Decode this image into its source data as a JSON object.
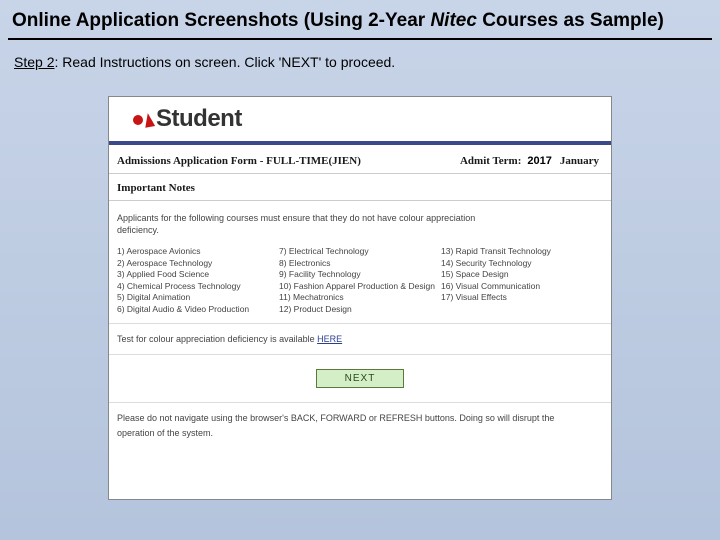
{
  "page": {
    "title_pre": "Online Application Screenshots (Using 2-Year ",
    "title_italic": "Nitec",
    "title_post": " Courses as Sample)"
  },
  "step": {
    "label": "Step 2",
    "text": ": Read Instructions on screen. Click 'NEXT' to proceed."
  },
  "screenshot": {
    "logo_text": "Student",
    "form_title": "Admissions Application Form - FULL-TIME(JIEN)",
    "admit_term_label": "Admit Term:",
    "year": "2017",
    "month": "January",
    "important_label": "Important Notes",
    "note_line1": "Applicants for the following courses must ensure that they do not have colour appreciation",
    "note_line2": "deficiency.",
    "courses_col1": [
      "1) Aerospace Avionics",
      "2) Aerospace Technology",
      "3) Applied Food Science",
      "4) Chemical Process Technology",
      "5) Digital Animation",
      "6) Digital Audio & Video Production"
    ],
    "courses_col2": [
      "7) Electrical Technology",
      "8) Electronics",
      "9) Facility Technology",
      "10) Fashion Apparel Production & Design",
      "11) Mechatronics",
      "12) Product Design"
    ],
    "courses_col3": [
      "13) Rapid Transit Technology",
      "14) Security Technology",
      "15) Space Design",
      "16) Visual Communication",
      "17) Visual Effects"
    ],
    "test_text": "Test for colour appreciation deficiency is available ",
    "test_link": "HERE",
    "next_label": "NEXT",
    "footer_line1": "Please do not navigate using the browser's BACK, FORWARD or REFRESH buttons. Doing so will disrupt the",
    "footer_line2": "operation of the system."
  }
}
